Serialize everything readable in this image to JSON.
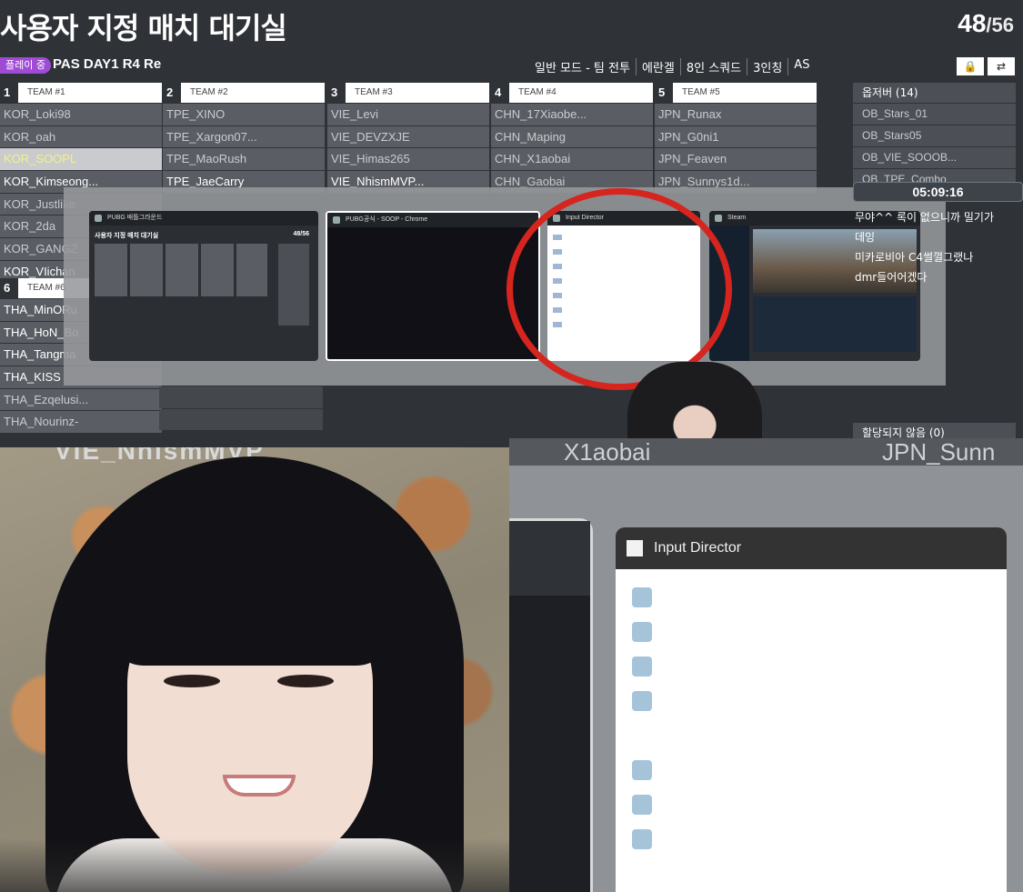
{
  "lobby": {
    "title": "사용자 지정 매치 대기실",
    "player_count": "48",
    "player_total": "/56",
    "status": "플레이 중",
    "match_name": "PAS DAY1 R4 Re",
    "settings": [
      "일반 모드 - 팀 전투",
      "에란겔",
      "8인 스쿼드",
      "3인칭",
      "AS"
    ],
    "lock_icon": "lock-icon",
    "swap_icon": "swap-icon"
  },
  "teams": [
    {
      "num": "1",
      "label": "TEAM #1",
      "players": [
        "KOR_Loki98",
        "KOR_oah",
        "KOR_SOOPL",
        "KOR_Kimseong..."
      ]
    },
    {
      "num": "2",
      "label": "TEAM #2",
      "players": [
        "TPE_XINO",
        "TPE_Xargon07...",
        "TPE_MaoRush",
        "TPE_JaeCarry"
      ]
    },
    {
      "num": "3",
      "label": "TEAM #3",
      "players": [
        "VIE_Levi",
        "VIE_DEVZXJE",
        "VIE_Himas265",
        "VIE_NhismMVP..."
      ]
    },
    {
      "num": "4",
      "label": "TEAM #4",
      "players": [
        "CHN_17Xiaobe...",
        "CHN_Maping",
        "CHN_X1aobai",
        "CHN_Gaobai"
      ]
    },
    {
      "num": "5",
      "label": "TEAM #5",
      "players": [
        "JPN_Runax",
        "JPN_G0ni1",
        "JPN_Feaven",
        "JPN_Sunnys1d..."
      ]
    }
  ],
  "team1_more": [
    "KOR_Justlike",
    "KOR_2da",
    "KOR_GANGZ",
    "KOR_VIichan"
  ],
  "team6": {
    "num": "6",
    "label": "TEAM #6",
    "players": [
      "THA_MinORu",
      "THA_HoN_Bo",
      "THA_Tangma",
      "THA_KISS",
      "THA_Ezqelusi...",
      "THA_Nourinz-"
    ]
  },
  "observers": {
    "header": "옵저버 (14)",
    "items": [
      "OB_Stars_01",
      "OB_Stars05",
      "OB_VIE_SOOOB...",
      "OB_TPE_Combo"
    ]
  },
  "unassigned": "할당되지 않음 (0)",
  "timer": "05:09:16",
  "chat": [
    "무야^^ 록이 없으니까 밀기가",
    "데잉",
    "미카로비아 C4썰껄그랬나",
    "dmr들어어겠다"
  ],
  "switcher": {
    "windows": [
      {
        "title": "PUBG 배틀그라운드",
        "mini_title": "사용자 지정 매치 대기실",
        "mini_count": "48/56"
      },
      {
        "title": "PUBG공식 - SOOP - Chrome"
      },
      {
        "title": "Input Director"
      },
      {
        "title": "Steam"
      }
    ]
  },
  "cam": {
    "ghost_name": "VIE_NhismMVP"
  },
  "zoom": {
    "top_left": "X1aobai",
    "top_right": "JPN_Sunn",
    "window_title": "Input Director"
  }
}
